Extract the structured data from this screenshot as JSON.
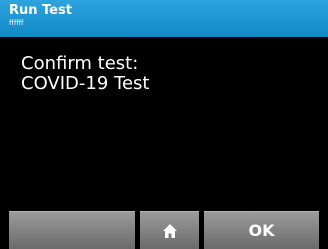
{
  "header": {
    "title": "Run Test",
    "subtitle": "ffffff"
  },
  "message": {
    "line1": "Confirm test:",
    "line2": "COVID-19 Test"
  },
  "footer": {
    "left_label": "",
    "home_icon": "home-icon",
    "ok_label": "OK"
  },
  "colors": {
    "title_bar": "#1a95d2",
    "background": "#000000",
    "button": "#7f7f7f",
    "text": "#ffffff"
  }
}
